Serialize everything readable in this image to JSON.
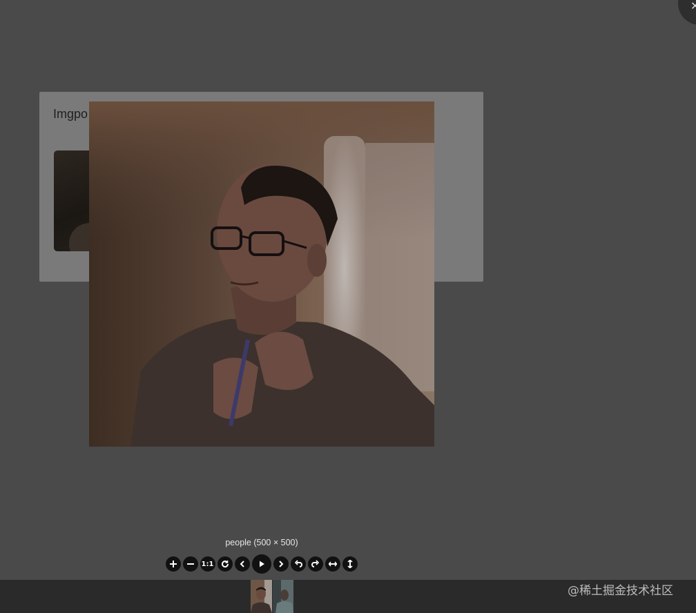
{
  "page": {
    "card_title": "Imgpo"
  },
  "viewer": {
    "close_icon": "close-icon",
    "caption": "people (500 × 500)",
    "toolbar": [
      {
        "name": "zoom-in-button",
        "icon": "plus-icon",
        "glyph": "+"
      },
      {
        "name": "zoom-out-button",
        "icon": "minus-icon",
        "glyph": "−"
      },
      {
        "name": "one-to-one-button",
        "icon": "one-to-one-icon",
        "glyph": "1:1"
      },
      {
        "name": "reset-button",
        "icon": "reset-icon",
        "glyph": "↻"
      },
      {
        "name": "prev-button",
        "icon": "chevron-left-icon",
        "glyph": "‹"
      },
      {
        "name": "play-button",
        "icon": "play-icon",
        "glyph": "▶"
      },
      {
        "name": "next-button",
        "icon": "chevron-right-icon",
        "glyph": "›"
      },
      {
        "name": "rotate-left-button",
        "icon": "rotate-left-icon",
        "glyph": "↶"
      },
      {
        "name": "rotate-right-button",
        "icon": "rotate-right-icon",
        "glyph": "↷"
      },
      {
        "name": "flip-horizontal-button",
        "icon": "flip-horizontal-icon",
        "glyph": "↔"
      },
      {
        "name": "flip-vertical-button",
        "icon": "flip-vertical-icon",
        "glyph": "↕"
      }
    ],
    "thumbnails": [
      {
        "name": "thumbnail-people",
        "active": true
      },
      {
        "name": "thumbnail-second",
        "active": false
      }
    ]
  },
  "watermark": "@稀土掘金技术社区",
  "colors": {
    "overlay": "#4a4a4a",
    "navbar": "#2a2a2a",
    "button": "#111111"
  }
}
